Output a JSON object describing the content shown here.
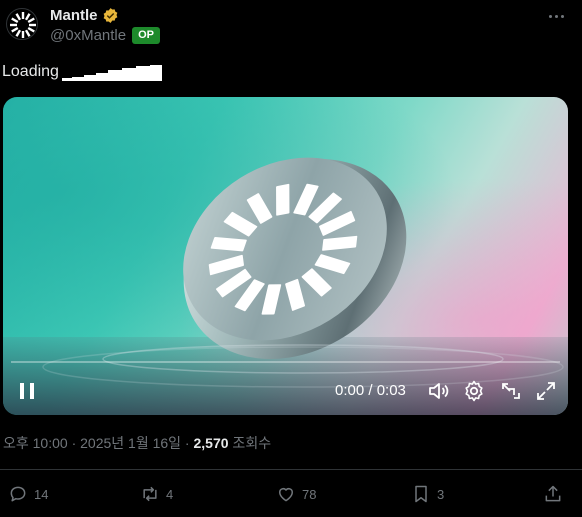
{
  "author": {
    "display_name": "Mantle",
    "handle": "@0xMantle",
    "badge": "OP",
    "verified_color": "#e8b63a"
  },
  "tweet": {
    "text": "Loading"
  },
  "video": {
    "current_time": "0:00",
    "duration": "0:03",
    "time_display": "0:00 / 0:03",
    "progress": 0
  },
  "meta": {
    "timestamp": "오후 10:00 · 2025년 1월 16일 · ",
    "views_count": "2,570",
    "views_label": " 조회수"
  },
  "actions": {
    "replies": "14",
    "reposts": "4",
    "likes": "78",
    "bookmarks": "3"
  },
  "colors": {
    "background": "#000000",
    "text": "#e7e9ea",
    "muted": "#71767b",
    "op_badge": "#1d8a2b"
  }
}
